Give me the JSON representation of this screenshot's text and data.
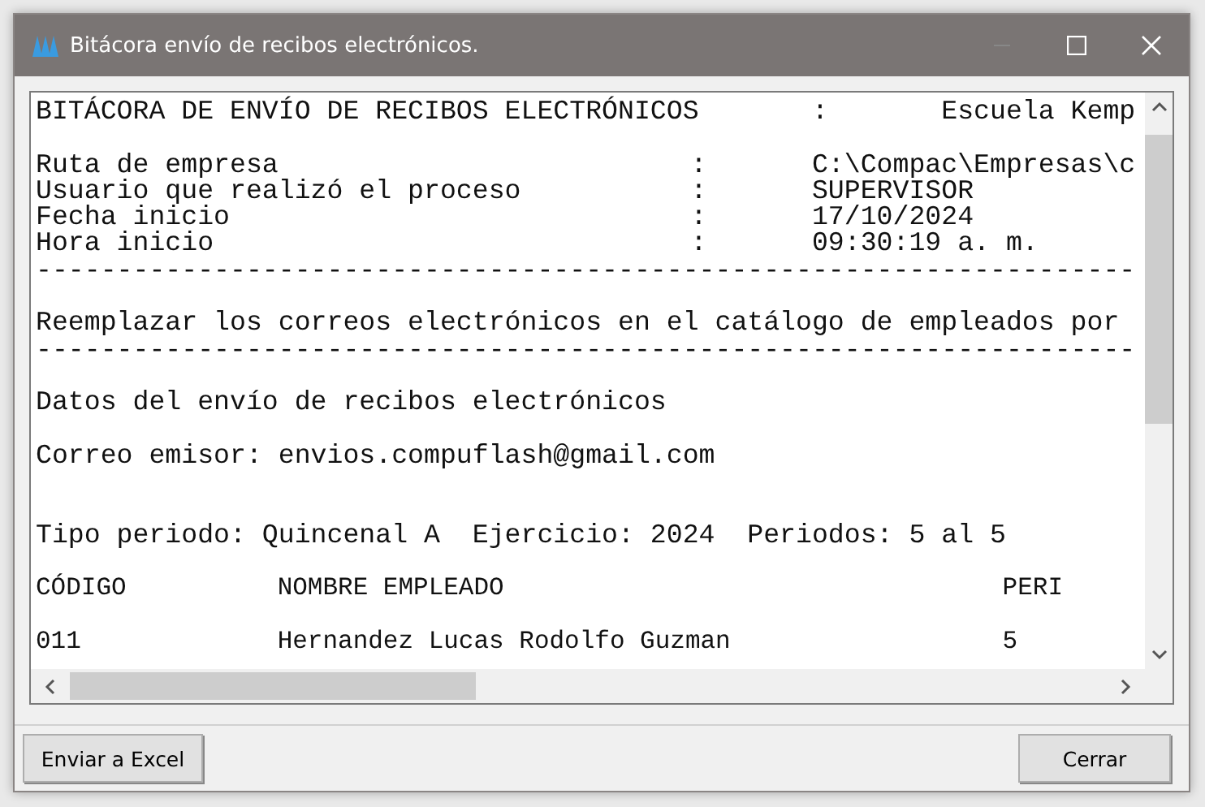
{
  "window": {
    "title": "Bitácora envío de recibos electrónicos."
  },
  "log": [
    {
      "kind": "title",
      "label": "BITÁCORA DE ENVÍO DE RECIBOS ELECTRÓNICOS",
      "colon": ":",
      "value": "Escuela Kemp"
    },
    {
      "kind": "blank"
    },
    {
      "kind": "field",
      "label": "Ruta de empresa",
      "colon": ":",
      "value": "C:\\Compac\\Empresas\\c"
    },
    {
      "kind": "field",
      "label": "Usuario que realizó el proceso",
      "colon": ":",
      "value": "SUPERVISOR"
    },
    {
      "kind": "field",
      "label": "Fecha inicio",
      "colon": ":",
      "value": "17/10/2024"
    },
    {
      "kind": "field",
      "label": "Hora inicio",
      "colon": ":",
      "value": "09:30:19 a. m."
    },
    {
      "kind": "rule",
      "text": "--------------------------------------------------------------------"
    },
    {
      "kind": "blank"
    },
    {
      "kind": "text",
      "text": "Reemplazar los correos electrónicos en el catálogo de empleados por"
    },
    {
      "kind": "rule",
      "text": "--------------------------------------------------------------------"
    },
    {
      "kind": "blank"
    },
    {
      "kind": "text",
      "text": "Datos del envío de recibos electrónicos"
    },
    {
      "kind": "blank"
    },
    {
      "kind": "text",
      "text": "Correo emisor: envios.compuflash@gmail.com"
    },
    {
      "kind": "blank"
    },
    {
      "kind": "blank"
    },
    {
      "kind": "text",
      "text": "Tipo periodo: Quincenal A  Ejercicio: 2024  Periodos: 5 al 5"
    },
    {
      "kind": "blank"
    },
    {
      "kind": "columns",
      "cells": [
        "CÓDIGO",
        "NOMBRE EMPLEADO",
        "PERI"
      ]
    },
    {
      "kind": "blank"
    },
    {
      "kind": "columns",
      "cells": [
        "011",
        "Hernandez Lucas Rodolfo Guzman",
        "5"
      ]
    }
  ],
  "buttons": [
    {
      "label": "Enviar a Excel",
      "kind": "left"
    },
    {
      "label": "Cerrar",
      "kind": "right"
    }
  ]
}
